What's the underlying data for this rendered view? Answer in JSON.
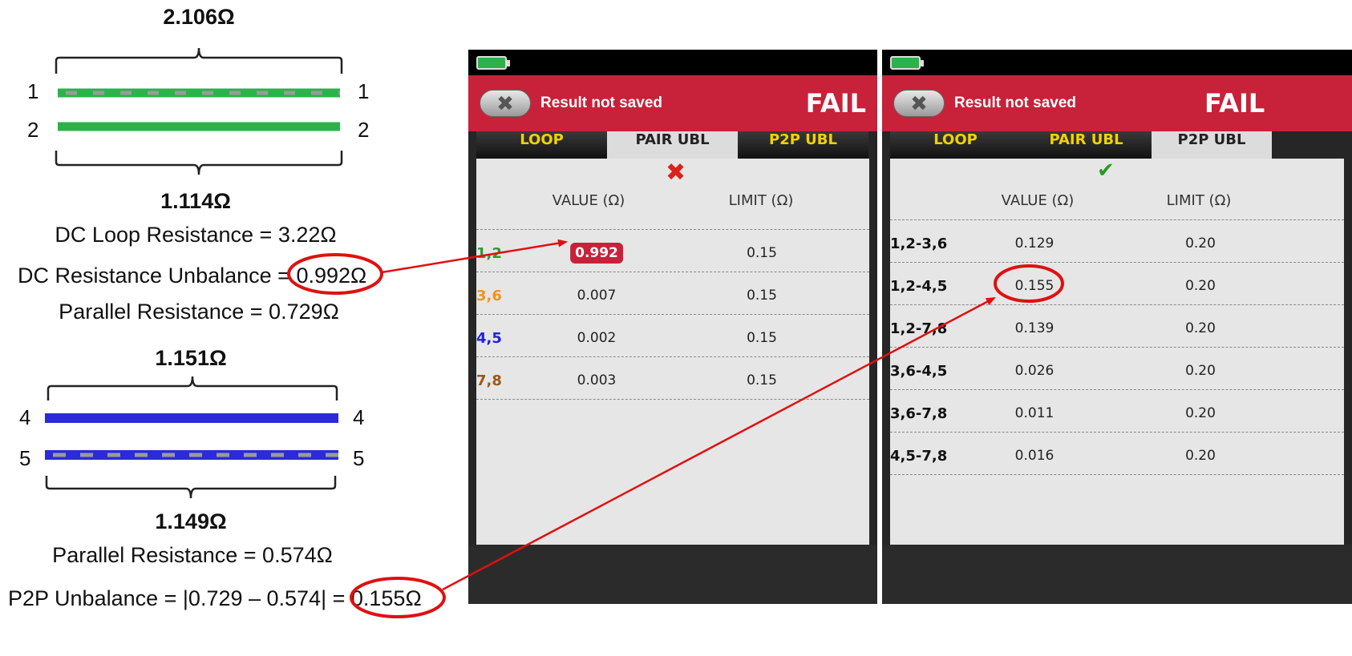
{
  "diagram": {
    "top_group": {
      "total": "2.106Ω",
      "pin_a": "1",
      "pin_b": "2",
      "bottom_resistance": "1.114Ω",
      "wire_color": "#2bb34a"
    },
    "formulas": {
      "loop": "DC Loop Resistance = 3.22Ω",
      "unbalance_prefix": "DC Resistance Unbalance = ",
      "unbalance_value": "0.992Ω",
      "parallel_1": "Parallel Resistance = 0.729Ω"
    },
    "bottom_group": {
      "top_resistance": "1.151Ω",
      "pin_a": "4",
      "pin_b": "5",
      "bottom_resistance": "1.149Ω",
      "wire_color": "#2b2bd8",
      "parallel_2": "Parallel Resistance = 0.574Ω"
    },
    "p2p": {
      "prefix": "P2P Unbalance = |0.729 – 0.574| = ",
      "value": "0.155Ω"
    },
    "highlight_color": "#e01010"
  },
  "screens": [
    {
      "status": "Result not saved",
      "verdict": "FAIL",
      "close_glyph": "✖",
      "tabs": [
        "LOOP",
        "PAIR UBL",
        "P2P UBL"
      ],
      "active_tab": 1,
      "indicator": "✖",
      "indicator_color": "#d8241c",
      "headers": [
        "VALUE (Ω)",
        "LIMIT (Ω)"
      ],
      "rows": [
        {
          "label": "1,2",
          "value": "0.992",
          "limit": "0.15",
          "color": "#2e9a2e",
          "fail": true
        },
        {
          "label": "3,6",
          "value": "0.007",
          "limit": "0.15",
          "color": "#f0921e",
          "fail": false
        },
        {
          "label": "4,5",
          "value": "0.002",
          "limit": "0.15",
          "color": "#2222dd",
          "fail": false
        },
        {
          "label": "7,8",
          "value": "0.003",
          "limit": "0.15",
          "color": "#9a5a14",
          "fail": false
        }
      ]
    },
    {
      "status": "Result not saved",
      "verdict": "FAIL",
      "close_glyph": "✖",
      "tabs": [
        "LOOP",
        "PAIR UBL",
        "P2P UBL"
      ],
      "active_tab": 2,
      "indicator": "✔",
      "indicator_color": "#2a9a2a",
      "headers": [
        "VALUE (Ω)",
        "LIMIT (Ω)"
      ],
      "rows": [
        {
          "label": "1,2-3,6",
          "value": "0.129",
          "limit": "0.20",
          "color": "#111111",
          "fail": false
        },
        {
          "label": "1,2-4,5",
          "value": "0.155",
          "limit": "0.20",
          "color": "#111111",
          "fail": false
        },
        {
          "label": "1,2-7,8",
          "value": "0.139",
          "limit": "0.20",
          "color": "#111111",
          "fail": false
        },
        {
          "label": "3,6-4,5",
          "value": "0.026",
          "limit": "0.20",
          "color": "#111111",
          "fail": false
        },
        {
          "label": "3,6-7,8",
          "value": "0.011",
          "limit": "0.20",
          "color": "#111111",
          "fail": false
        },
        {
          "label": "4,5-7,8",
          "value": "0.016",
          "limit": "0.20",
          "color": "#111111",
          "fail": false
        }
      ]
    }
  ]
}
